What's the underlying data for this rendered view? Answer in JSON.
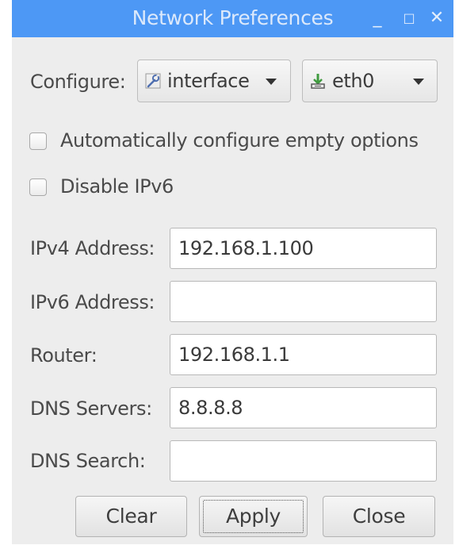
{
  "window": {
    "title": "Network Preferences",
    "controls": {
      "minimize": "_",
      "maximize": "□",
      "close": "✕"
    }
  },
  "configure": {
    "label": "Configure:",
    "type_selector": {
      "value": "interface",
      "icon": "wrench-icon"
    },
    "device_selector": {
      "value": "eth0",
      "icon": "network-port-icon"
    }
  },
  "options": {
    "auto_configure": {
      "label": "Automatically configure empty options",
      "checked": false
    },
    "disable_ipv6": {
      "label": "Disable IPv6",
      "checked": false
    }
  },
  "fields": {
    "ipv4": {
      "label": "IPv4 Address:",
      "value": "192.168.1.100"
    },
    "ipv6": {
      "label": "IPv6 Address:",
      "value": ""
    },
    "router": {
      "label": "Router:",
      "value": "192.168.1.1"
    },
    "dns_servers": {
      "label": "DNS Servers:",
      "value": "8.8.8.8"
    },
    "dns_search": {
      "label": "DNS Search:",
      "value": ""
    }
  },
  "buttons": {
    "clear": "Clear",
    "apply": "Apply",
    "close": "Close"
  },
  "colors": {
    "titlebar": "#4d98f5",
    "window_bg": "#ededed",
    "network_icon": "#3f9b3f"
  }
}
